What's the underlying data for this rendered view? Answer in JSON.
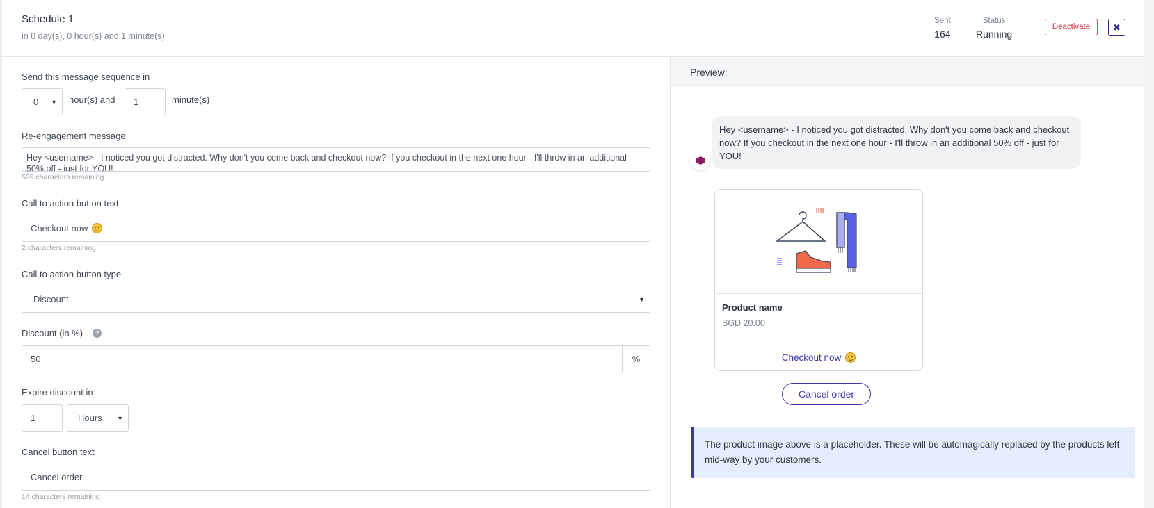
{
  "header": {
    "title": "Schedule 1",
    "subtitle": "in 0 day(s), 0 hour(s) and 1 minute(s)",
    "sent_label": "Sent",
    "sent_value": "164",
    "status_label": "Status",
    "status_value": "Running",
    "deactivate_label": "Deactivate",
    "close_icon": "close-icon"
  },
  "form": {
    "send_label": "Send this message sequence in",
    "hours_value": "0",
    "hours_suffix": "hour(s) and",
    "minutes_value": "1",
    "minutes_suffix": "minute(s)",
    "reengage_label": "Re-engagement message",
    "reengage_value": "Hey <username> - I noticed you got distracted. Why don't you come back and checkout now? If you checkout in the next one hour - I'll throw in an additional 50% off - just for YOU!",
    "reengage_hint": "599 characters remaining",
    "cta_text_label": "Call to action button text",
    "cta_text_value": "Checkout now",
    "cta_text_hint": "2 characters remaining",
    "cta_type_label": "Call to action button type",
    "cta_type_value": "Discount",
    "discount_label": "Discount (in %)",
    "discount_value": "50",
    "discount_addon": "%",
    "expire_label": "Expire discount in",
    "expire_value": "1",
    "expire_unit": "Hours",
    "cancel_label": "Cancel button text",
    "cancel_value": "Cancel order",
    "cancel_hint": "14 characters remaining"
  },
  "preview": {
    "title": "Preview:",
    "message": "Hey <username> - I noticed you got distracted. Why don't you come back and checkout now? If you checkout in the next one hour - I'll throw in an additional 50% off - just for YOU!",
    "product_name": "Product name",
    "product_price": "SGD 20.00",
    "cta": "Checkout now",
    "cancel": "Cancel order",
    "info": "The product image above is a placeholder. These will be automagically replaced by the products left mid-way by your customers."
  },
  "colors": {
    "accent": "#3a37a8",
    "danger": "#e0353f",
    "info_bg": "#e4edfb"
  }
}
